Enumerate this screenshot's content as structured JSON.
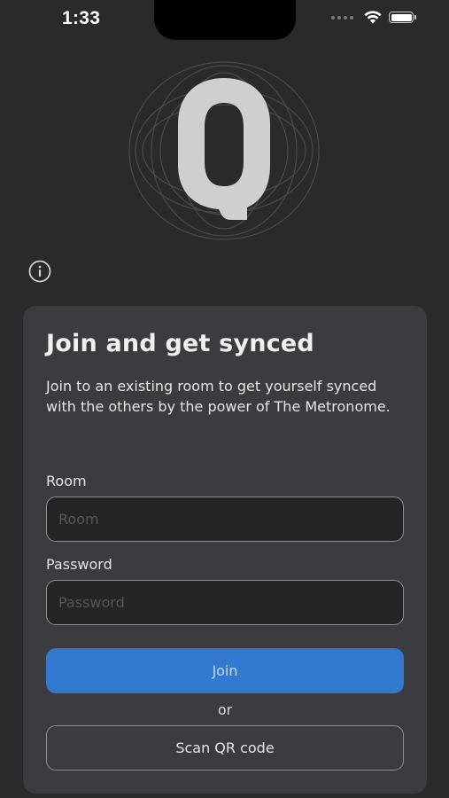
{
  "status_bar": {
    "time": "1:33",
    "icons": [
      "signal-dots-icon",
      "wifi-icon",
      "battery-icon"
    ],
    "battery_level": 1.0
  },
  "logo": {
    "letter": "Q",
    "icon": "q-logo-icon"
  },
  "info": {
    "icon": "info-icon"
  },
  "card": {
    "title": "Join and get synced",
    "description": "Join to an existing room to get yourself synced with the others by the power of The Metronome.",
    "room": {
      "label": "Room",
      "value": "",
      "placeholder": "Room"
    },
    "password": {
      "label": "Password",
      "value": "",
      "placeholder": "Password"
    },
    "join_label": "Join",
    "or_label": "or",
    "scan_label": "Scan QR code"
  },
  "colors": {
    "background": "#2a2a2b",
    "card": "#3b3c40",
    "accent": "#3279cf",
    "input_bg": "#252527",
    "border": "#8e8f93"
  }
}
